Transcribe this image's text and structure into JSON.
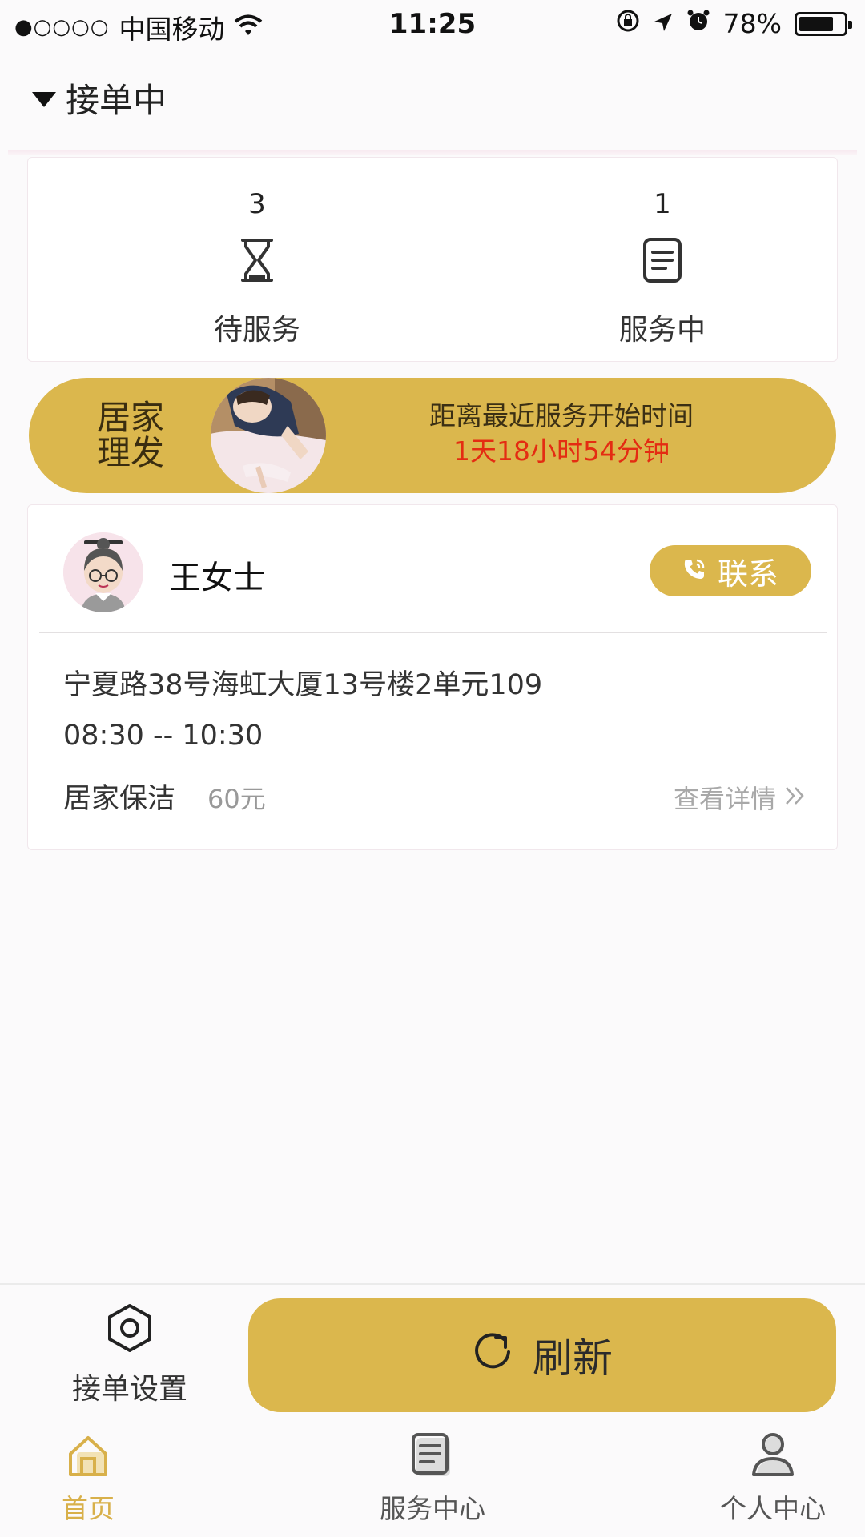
{
  "status_bar": {
    "signal_dots": "●○○○○",
    "carrier": "中国移动",
    "time": "11:25",
    "battery_percent": "78%",
    "battery_level": 0.78
  },
  "header": {
    "title": "接单中"
  },
  "counts": [
    {
      "count": "3",
      "label": "待服务",
      "icon": "hourglass-icon"
    },
    {
      "count": "1",
      "label": "服务中",
      "icon": "document-icon"
    }
  ],
  "banner": {
    "title_line1": "居家",
    "title_line2": "理发",
    "next_label": "距离最近服务开始时间",
    "countdown": "1天18小时54分钟"
  },
  "order": {
    "customer": "王女士",
    "contact_label": "联系",
    "address": "宁夏路38号海虹大厦13号楼2单元109",
    "time_range": "08:30 -- 10:30",
    "service": "居家保洁",
    "price": "60元",
    "detail_label": "查看详情"
  },
  "actions": {
    "settings_label": "接单设置",
    "refresh_label": "刷新"
  },
  "tabs": [
    {
      "label": "首页",
      "icon": "home-icon",
      "active": true
    },
    {
      "label": "服务中心",
      "icon": "document-icon",
      "active": false
    },
    {
      "label": "个人中心",
      "icon": "user-icon",
      "active": false
    }
  ],
  "colors": {
    "accent": "#dbb74d",
    "countdown": "#e42c12",
    "active_tab": "#d8b04a",
    "inactive_tab": "#555555"
  }
}
